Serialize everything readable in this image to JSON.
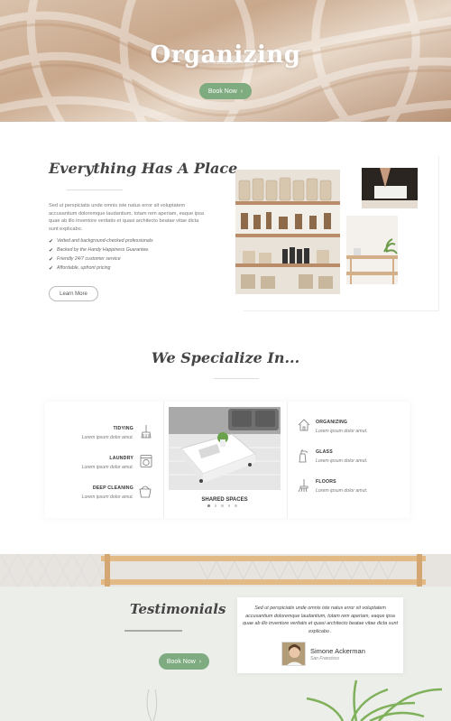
{
  "hero": {
    "title": "Organizing",
    "button_label": "Book Now",
    "button_arrow": "›"
  },
  "place": {
    "title": "Everything Has A Place",
    "text": "Sed ut perspiciatis unde omnis iste natus error sit voluptatem accusantium doloremque laudantium, totam rem aperiam, eaque ipsa quae ab illo inventore veritatis et quasi architecto beatae vitae dicta sunt explicabo.",
    "checklist": [
      "Vetted and background-checked professionals",
      "Backed by the Handy Happiness Guarantee.",
      "Friendly 24/7 customer service",
      "Affordable, upfront pricing"
    ],
    "check_glyph": "✔",
    "button_label": "Learn More"
  },
  "specialize": {
    "title": "We Specialize In...",
    "left": [
      {
        "name": "TIDYING",
        "desc": "Lorem ipsum dolor amut.",
        "icon": "broom-icon"
      },
      {
        "name": "LAUNDRY",
        "desc": "Lorem ipsum dolor amut.",
        "icon": "washing-machine-icon"
      },
      {
        "name": "DEEP CLEANING",
        "desc": "Lorem ipsum dolor amut.",
        "icon": "bucket-icon"
      }
    ],
    "right": [
      {
        "name": "ORGANIZING",
        "desc": "Lorem ipsum dolor amut.",
        "icon": "house-icon"
      },
      {
        "name": "GLASS",
        "desc": "Lorem ipsum dolor amut.",
        "icon": "spray-bottle-icon"
      },
      {
        "name": "FLOORS",
        "desc": "Lorem ipsum dolor amut.",
        "icon": "mop-icon"
      }
    ],
    "center_label": "SHARED SPACES",
    "slider_dots": 5,
    "active_dot": 0
  },
  "testimonials": {
    "title": "Testimonials",
    "quote": "Sed ut perspiciatis unde omnis iste natus error sit voluptatem accusantium doloremque laudantium, totam rem aperiam, eaque ipsa quae ab illo inventore veritatis et quasi architecto beatae vitae dicta sunt explicabo .",
    "name": "Simone Ackerman",
    "location": "San Francisco",
    "button_label": "Book Now",
    "button_arrow": "›"
  },
  "colors": {
    "accent_green": "#7eab7f",
    "heading": "#444444"
  }
}
